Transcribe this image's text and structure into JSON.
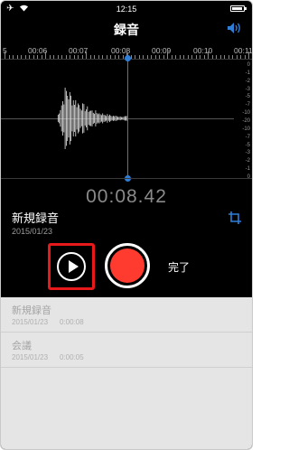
{
  "status_bar": {
    "time": "12:15"
  },
  "nav": {
    "title": "録音"
  },
  "timeline": {
    "labels": [
      "5",
      "00:06",
      "00:07",
      "00:08",
      "00:09",
      "00:10",
      "00:11"
    ]
  },
  "db_scale": [
    "0",
    "-1",
    "-2",
    "-3",
    "-5",
    "-7",
    "-10",
    "-20",
    "-10",
    "-7",
    "-5",
    "-3",
    "-2",
    "-1",
    "0"
  ],
  "player": {
    "elapsed": "00:08.42",
    "recording_name": "新規録音",
    "recording_date": "2015/01/23",
    "done_label": "完了"
  },
  "recordings": [
    {
      "title": "新規録音",
      "date": "2015/01/23",
      "duration": "0:00:08"
    },
    {
      "title": "会議",
      "date": "2015/01/23",
      "duration": "0:00:05"
    }
  ],
  "colors": {
    "accent": "#2f7fd9",
    "record": "#ff3b30",
    "highlight": "#e8191b"
  }
}
